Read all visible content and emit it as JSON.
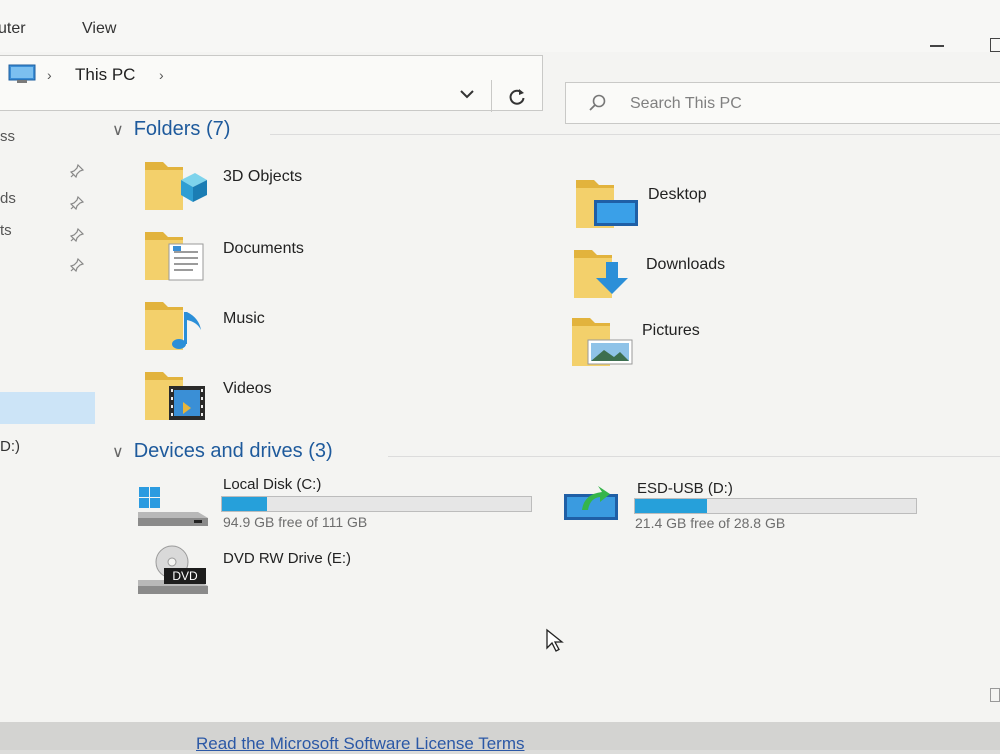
{
  "ribbon": {
    "tab_computer": "uter",
    "tab_view": "View"
  },
  "address": {
    "location": "This PC",
    "icon": "this-pc-icon"
  },
  "search": {
    "placeholder": "Search This PC"
  },
  "nav": {
    "items": [
      "ss",
      "ds",
      "ts"
    ],
    "drive": "D:)"
  },
  "folders": {
    "header": "Folders (7)",
    "items": [
      {
        "label": "3D Objects",
        "icon": "3d-objects-folder-icon"
      },
      {
        "label": "Desktop",
        "icon": "desktop-folder-icon"
      },
      {
        "label": "Documents",
        "icon": "documents-folder-icon"
      },
      {
        "label": "Downloads",
        "icon": "downloads-folder-icon"
      },
      {
        "label": "Music",
        "icon": "music-folder-icon"
      },
      {
        "label": "Pictures",
        "icon": "pictures-folder-icon"
      },
      {
        "label": "Videos",
        "icon": "videos-folder-icon"
      }
    ]
  },
  "devices": {
    "header": "Devices and drives (3)",
    "drives": [
      {
        "name": "Local Disk (C:)",
        "free_text": "94.9 GB free of 111 GB",
        "used_fraction": 0.145,
        "icon": "local-disk-icon"
      },
      {
        "name": "ESD-USB (D:)",
        "free_text": "21.4 GB free of 28.8 GB",
        "used_fraction": 0.257,
        "icon": "usb-drive-icon"
      },
      {
        "name": "DVD RW Drive (E:)",
        "icon": "dvd-drive-icon",
        "badge": "DVD"
      }
    ]
  },
  "footer": {
    "license_link": "Read the Microsoft Software License Terms"
  },
  "colors": {
    "accent": "#26a0da",
    "section_header": "#1e5a9c",
    "folder": "#f3d06b"
  }
}
